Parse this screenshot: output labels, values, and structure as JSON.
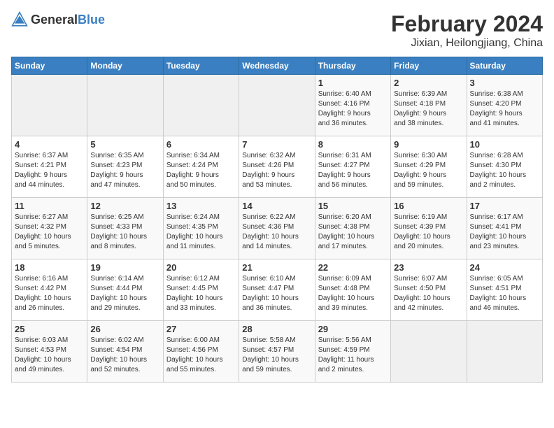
{
  "header": {
    "logo_general": "General",
    "logo_blue": "Blue",
    "month_year": "February 2024",
    "location": "Jixian, Heilongjiang, China"
  },
  "days_of_week": [
    "Sunday",
    "Monday",
    "Tuesday",
    "Wednesday",
    "Thursday",
    "Friday",
    "Saturday"
  ],
  "weeks": [
    {
      "days": [
        {
          "number": "",
          "info": "",
          "empty": true
        },
        {
          "number": "",
          "info": "",
          "empty": true
        },
        {
          "number": "",
          "info": "",
          "empty": true
        },
        {
          "number": "",
          "info": "",
          "empty": true
        },
        {
          "number": "1",
          "info": "Sunrise: 6:40 AM\nSunset: 4:16 PM\nDaylight: 9 hours\nand 36 minutes."
        },
        {
          "number": "2",
          "info": "Sunrise: 6:39 AM\nSunset: 4:18 PM\nDaylight: 9 hours\nand 38 minutes."
        },
        {
          "number": "3",
          "info": "Sunrise: 6:38 AM\nSunset: 4:20 PM\nDaylight: 9 hours\nand 41 minutes."
        }
      ]
    },
    {
      "days": [
        {
          "number": "4",
          "info": "Sunrise: 6:37 AM\nSunset: 4:21 PM\nDaylight: 9 hours\nand 44 minutes."
        },
        {
          "number": "5",
          "info": "Sunrise: 6:35 AM\nSunset: 4:23 PM\nDaylight: 9 hours\nand 47 minutes."
        },
        {
          "number": "6",
          "info": "Sunrise: 6:34 AM\nSunset: 4:24 PM\nDaylight: 9 hours\nand 50 minutes."
        },
        {
          "number": "7",
          "info": "Sunrise: 6:32 AM\nSunset: 4:26 PM\nDaylight: 9 hours\nand 53 minutes."
        },
        {
          "number": "8",
          "info": "Sunrise: 6:31 AM\nSunset: 4:27 PM\nDaylight: 9 hours\nand 56 minutes."
        },
        {
          "number": "9",
          "info": "Sunrise: 6:30 AM\nSunset: 4:29 PM\nDaylight: 9 hours\nand 59 minutes."
        },
        {
          "number": "10",
          "info": "Sunrise: 6:28 AM\nSunset: 4:30 PM\nDaylight: 10 hours\nand 2 minutes."
        }
      ]
    },
    {
      "days": [
        {
          "number": "11",
          "info": "Sunrise: 6:27 AM\nSunset: 4:32 PM\nDaylight: 10 hours\nand 5 minutes."
        },
        {
          "number": "12",
          "info": "Sunrise: 6:25 AM\nSunset: 4:33 PM\nDaylight: 10 hours\nand 8 minutes."
        },
        {
          "number": "13",
          "info": "Sunrise: 6:24 AM\nSunset: 4:35 PM\nDaylight: 10 hours\nand 11 minutes."
        },
        {
          "number": "14",
          "info": "Sunrise: 6:22 AM\nSunset: 4:36 PM\nDaylight: 10 hours\nand 14 minutes."
        },
        {
          "number": "15",
          "info": "Sunrise: 6:20 AM\nSunset: 4:38 PM\nDaylight: 10 hours\nand 17 minutes."
        },
        {
          "number": "16",
          "info": "Sunrise: 6:19 AM\nSunset: 4:39 PM\nDaylight: 10 hours\nand 20 minutes."
        },
        {
          "number": "17",
          "info": "Sunrise: 6:17 AM\nSunset: 4:41 PM\nDaylight: 10 hours\nand 23 minutes."
        }
      ]
    },
    {
      "days": [
        {
          "number": "18",
          "info": "Sunrise: 6:16 AM\nSunset: 4:42 PM\nDaylight: 10 hours\nand 26 minutes."
        },
        {
          "number": "19",
          "info": "Sunrise: 6:14 AM\nSunset: 4:44 PM\nDaylight: 10 hours\nand 29 minutes."
        },
        {
          "number": "20",
          "info": "Sunrise: 6:12 AM\nSunset: 4:45 PM\nDaylight: 10 hours\nand 33 minutes."
        },
        {
          "number": "21",
          "info": "Sunrise: 6:10 AM\nSunset: 4:47 PM\nDaylight: 10 hours\nand 36 minutes."
        },
        {
          "number": "22",
          "info": "Sunrise: 6:09 AM\nSunset: 4:48 PM\nDaylight: 10 hours\nand 39 minutes."
        },
        {
          "number": "23",
          "info": "Sunrise: 6:07 AM\nSunset: 4:50 PM\nDaylight: 10 hours\nand 42 minutes."
        },
        {
          "number": "24",
          "info": "Sunrise: 6:05 AM\nSunset: 4:51 PM\nDaylight: 10 hours\nand 46 minutes."
        }
      ]
    },
    {
      "days": [
        {
          "number": "25",
          "info": "Sunrise: 6:03 AM\nSunset: 4:53 PM\nDaylight: 10 hours\nand 49 minutes."
        },
        {
          "number": "26",
          "info": "Sunrise: 6:02 AM\nSunset: 4:54 PM\nDaylight: 10 hours\nand 52 minutes."
        },
        {
          "number": "27",
          "info": "Sunrise: 6:00 AM\nSunset: 4:56 PM\nDaylight: 10 hours\nand 55 minutes."
        },
        {
          "number": "28",
          "info": "Sunrise: 5:58 AM\nSunset: 4:57 PM\nDaylight: 10 hours\nand 59 minutes."
        },
        {
          "number": "29",
          "info": "Sunrise: 5:56 AM\nSunset: 4:59 PM\nDaylight: 11 hours\nand 2 minutes."
        },
        {
          "number": "",
          "info": "",
          "empty": true
        },
        {
          "number": "",
          "info": "",
          "empty": true
        }
      ]
    }
  ]
}
